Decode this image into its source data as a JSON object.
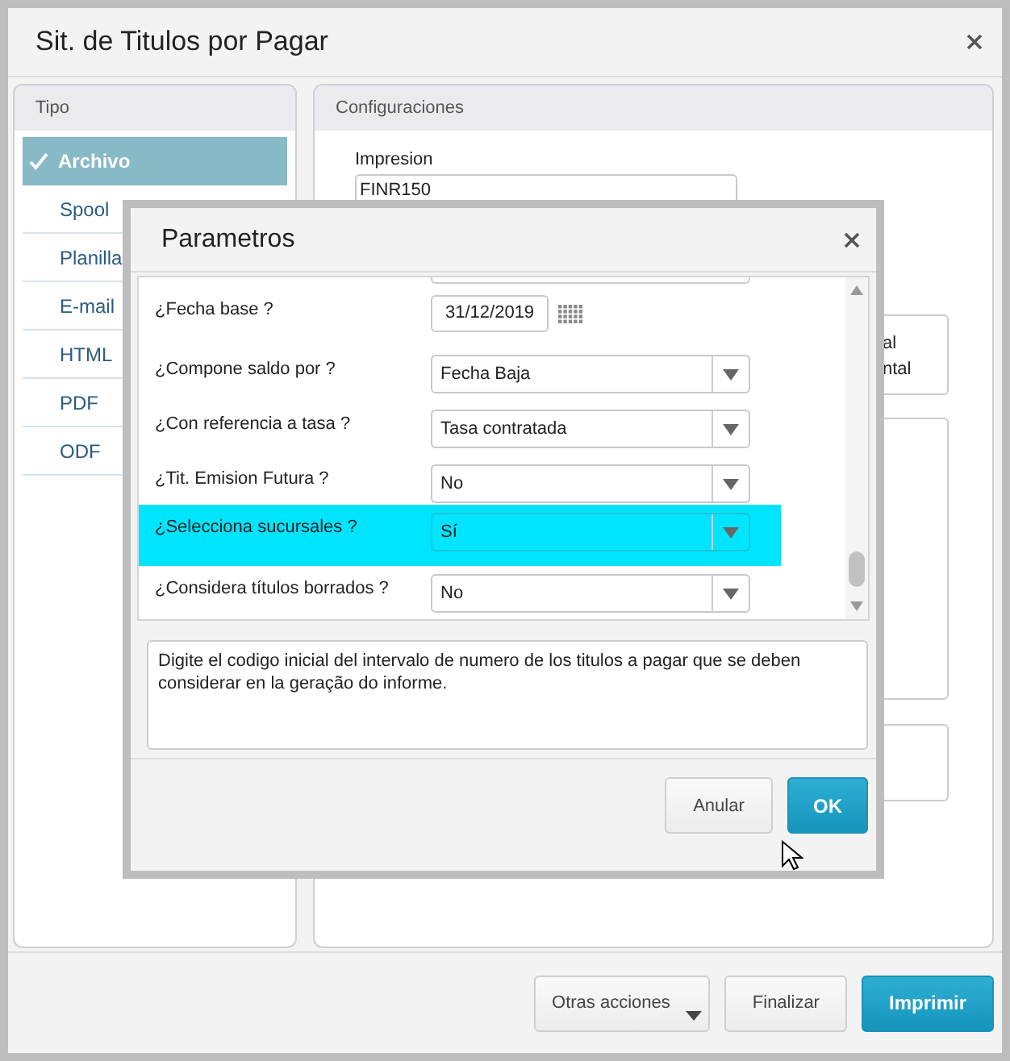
{
  "window": {
    "title": "Sit. de Titulos por Pagar"
  },
  "sidebar": {
    "title": "Tipo",
    "items": [
      {
        "label": "Archivo",
        "selected": true
      },
      {
        "label": "Spool",
        "selected": false
      },
      {
        "label": "Planilla",
        "selected": false
      },
      {
        "label": "E-mail",
        "selected": false
      },
      {
        "label": "HTML",
        "selected": false
      },
      {
        "label": "PDF",
        "selected": false
      },
      {
        "label": "ODF",
        "selected": false
      }
    ]
  },
  "config": {
    "title": "Configuraciones",
    "impresion_label": "Impresion",
    "impresion_value": "FINR150",
    "option_lines": [
      "al",
      "ntal"
    ]
  },
  "dialog": {
    "title": "Parametros",
    "rows": [
      {
        "kind": "date",
        "label": "¿Fecha base ?",
        "value": "31/12/2019",
        "selected": false
      },
      {
        "kind": "select",
        "label": "¿Compone saldo por ?",
        "value": "Fecha Baja",
        "selected": false
      },
      {
        "kind": "select",
        "label": "¿Con referencia a tasa ?",
        "value": "Tasa contratada",
        "selected": false
      },
      {
        "kind": "select",
        "label": "¿Tit. Emision Futura ?",
        "value": "No",
        "selected": false
      },
      {
        "kind": "select",
        "label": "¿Selecciona sucursales ?",
        "value": "Sí",
        "selected": true
      },
      {
        "kind": "select",
        "label": "¿Considera títulos borrados ?",
        "value": "No",
        "selected": false
      }
    ],
    "description": "Digite el codigo inicial del intervalo de numero de los titulos a pagar que se deben considerar en la geração do informe.",
    "buttons": [
      {
        "label": "Anular",
        "kind": "secondary"
      },
      {
        "label": "OK",
        "kind": "primary"
      }
    ]
  },
  "footer_buttons": [
    {
      "label": "Otras acciones",
      "kind": "menu"
    },
    {
      "label": "Finalizar",
      "kind": "secondary"
    },
    {
      "label": "Imprimir",
      "kind": "primary"
    }
  ]
}
